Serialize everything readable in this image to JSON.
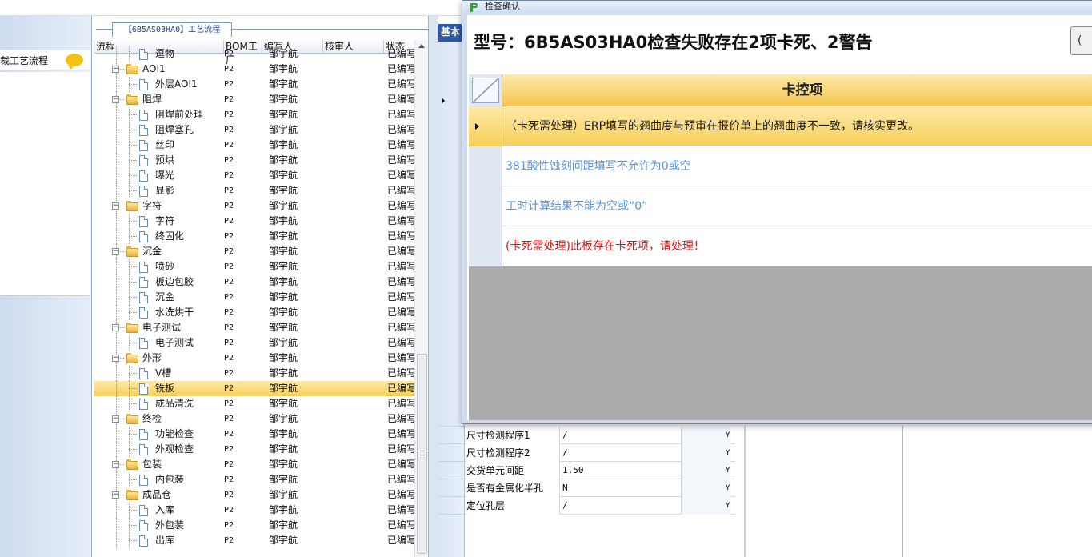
{
  "left_panel": {
    "item_label": "裁工艺流程"
  },
  "grid": {
    "group_title": "【6B5AS03HA0】工艺流程",
    "columns": [
      "流程",
      "BOM工厂",
      "编写人",
      "核审人",
      "状态"
    ],
    "rows": [
      {
        "name": "逗物",
        "bom": "P2",
        "writer": "邹宇航",
        "status": "已编写",
        "type": "doc",
        "level": 1
      },
      {
        "name": "AOI1",
        "bom": "P2",
        "writer": "邹宇航",
        "status": "已编写",
        "type": "folder",
        "level": 0
      },
      {
        "name": "外层AOI1",
        "bom": "P2",
        "writer": "邹宇航",
        "status": "已编写",
        "type": "doc",
        "level": 1
      },
      {
        "name": "阻焊",
        "bom": "P2",
        "writer": "邹宇航",
        "status": "已编写",
        "type": "folder",
        "level": 0
      },
      {
        "name": "阻焊前处理",
        "bom": "P2",
        "writer": "邹宇航",
        "status": "已编写",
        "type": "doc",
        "level": 1
      },
      {
        "name": "阻焊塞孔",
        "bom": "P2",
        "writer": "邹宇航",
        "status": "已编写",
        "type": "doc",
        "level": 1
      },
      {
        "name": "丝印",
        "bom": "P2",
        "writer": "邹宇航",
        "status": "已编写",
        "type": "doc",
        "level": 1
      },
      {
        "name": "预烘",
        "bom": "P2",
        "writer": "邹宇航",
        "status": "已编写",
        "type": "doc",
        "level": 1
      },
      {
        "name": "曝光",
        "bom": "P2",
        "writer": "邹宇航",
        "status": "已编写",
        "type": "doc",
        "level": 1
      },
      {
        "name": "显影",
        "bom": "P2",
        "writer": "邹宇航",
        "status": "已编写",
        "type": "doc",
        "level": 1
      },
      {
        "name": "字符",
        "bom": "P2",
        "writer": "邹宇航",
        "status": "已编写",
        "type": "folder",
        "level": 0
      },
      {
        "name": "字符",
        "bom": "P2",
        "writer": "邹宇航",
        "status": "已编写",
        "type": "doc",
        "level": 1
      },
      {
        "name": "终固化",
        "bom": "P2",
        "writer": "邹宇航",
        "status": "已编写",
        "type": "doc",
        "level": 1
      },
      {
        "name": "沉金",
        "bom": "P2",
        "writer": "邹宇航",
        "status": "已编写",
        "type": "folder",
        "level": 0
      },
      {
        "name": "喷砂",
        "bom": "P2",
        "writer": "邹宇航",
        "status": "已编写",
        "type": "doc",
        "level": 1
      },
      {
        "name": "板边包胶",
        "bom": "P2",
        "writer": "邹宇航",
        "status": "已编写",
        "type": "doc",
        "level": 1
      },
      {
        "name": "沉金",
        "bom": "P2",
        "writer": "邹宇航",
        "status": "已编写",
        "type": "doc",
        "level": 1
      },
      {
        "name": "水洗烘干",
        "bom": "P2",
        "writer": "邹宇航",
        "status": "已编写",
        "type": "doc",
        "level": 1
      },
      {
        "name": "电子测试",
        "bom": "P2",
        "writer": "邹宇航",
        "status": "已编写",
        "type": "folder",
        "level": 0
      },
      {
        "name": "电子测试",
        "bom": "P2",
        "writer": "邹宇航",
        "status": "已编写",
        "type": "doc",
        "level": 1
      },
      {
        "name": "外形",
        "bom": "P2",
        "writer": "邹宇航",
        "status": "已编写",
        "type": "folder",
        "level": 0
      },
      {
        "name": "V槽",
        "bom": "P2",
        "writer": "邹宇航",
        "status": "已编写",
        "type": "doc",
        "level": 1
      },
      {
        "name": "铣板",
        "bom": "P2",
        "writer": "邹宇航",
        "status": "已编写",
        "type": "doc",
        "level": 1,
        "selected": true
      },
      {
        "name": "成品清洗",
        "bom": "P2",
        "writer": "邹宇航",
        "status": "已编写",
        "type": "doc",
        "level": 1
      },
      {
        "name": "终检",
        "bom": "P2",
        "writer": "邹宇航",
        "status": "已编写",
        "type": "folder",
        "level": 0
      },
      {
        "name": "功能检查",
        "bom": "P2",
        "writer": "邹宇航",
        "status": "已编写",
        "type": "doc",
        "level": 1
      },
      {
        "name": "外观检查",
        "bom": "P2",
        "writer": "邹宇航",
        "status": "已编写",
        "type": "doc",
        "level": 1
      },
      {
        "name": "包装",
        "bom": "P2",
        "writer": "邹宇航",
        "status": "已编写",
        "type": "folder",
        "level": 0
      },
      {
        "name": "内包装",
        "bom": "P2",
        "writer": "邹宇航",
        "status": "已编写",
        "type": "doc",
        "level": 1
      },
      {
        "name": "成品仓",
        "bom": "P2",
        "writer": "邹宇航",
        "status": "已编写",
        "type": "folder",
        "level": 0
      },
      {
        "name": "入库",
        "bom": "P2",
        "writer": "邹宇航",
        "status": "已编写",
        "type": "doc",
        "level": 1
      },
      {
        "name": "外包装",
        "bom": "P2",
        "writer": "邹宇航",
        "status": "已编写",
        "type": "doc",
        "level": 1
      },
      {
        "name": "出库",
        "bom": "P2",
        "writer": "邹宇航",
        "status": "已编写",
        "type": "doc",
        "level": 1
      }
    ]
  },
  "middle": {
    "tab_label": "基本",
    "properties": [
      {
        "name": "尺寸检测程序1",
        "value": "/",
        "flag": "Y"
      },
      {
        "name": "尺寸检测程序2",
        "value": "/",
        "flag": "Y"
      },
      {
        "name": "交货单元间距",
        "value": "1.50",
        "flag": "Y"
      },
      {
        "name": "是否有金属化半孔",
        "value": "N",
        "flag": "Y"
      },
      {
        "name": "定位孔层",
        "value": "/",
        "flag": "Y"
      }
    ]
  },
  "dialog": {
    "title": "检查确认",
    "headline": "型号：6B5AS03HA0检查失败存在2项卡死、2警告",
    "corner_button": "(",
    "column_header": "卡控项",
    "items": [
      {
        "text": "（卡死需处理）ERP填写的翘曲度与预审在报价单上的翘曲度不一致，请核实更改。",
        "color": "#1a1a1a"
      },
      {
        "text": "381酸性蚀刻间距填写不允许为0或空",
        "color": "#5b8fd6"
      },
      {
        "text": "工时计算结果不能为空或“0”",
        "color": "#5b8fd6"
      },
      {
        "text": "(卡死需处理)此板存在卡死项，请处理！",
        "color": "#e01010"
      }
    ]
  },
  "colors": {
    "accent": "#2c58a7",
    "selected_row": "#f7cf58",
    "error_red": "#e01010",
    "warning_blue": "#5b8fd6"
  }
}
